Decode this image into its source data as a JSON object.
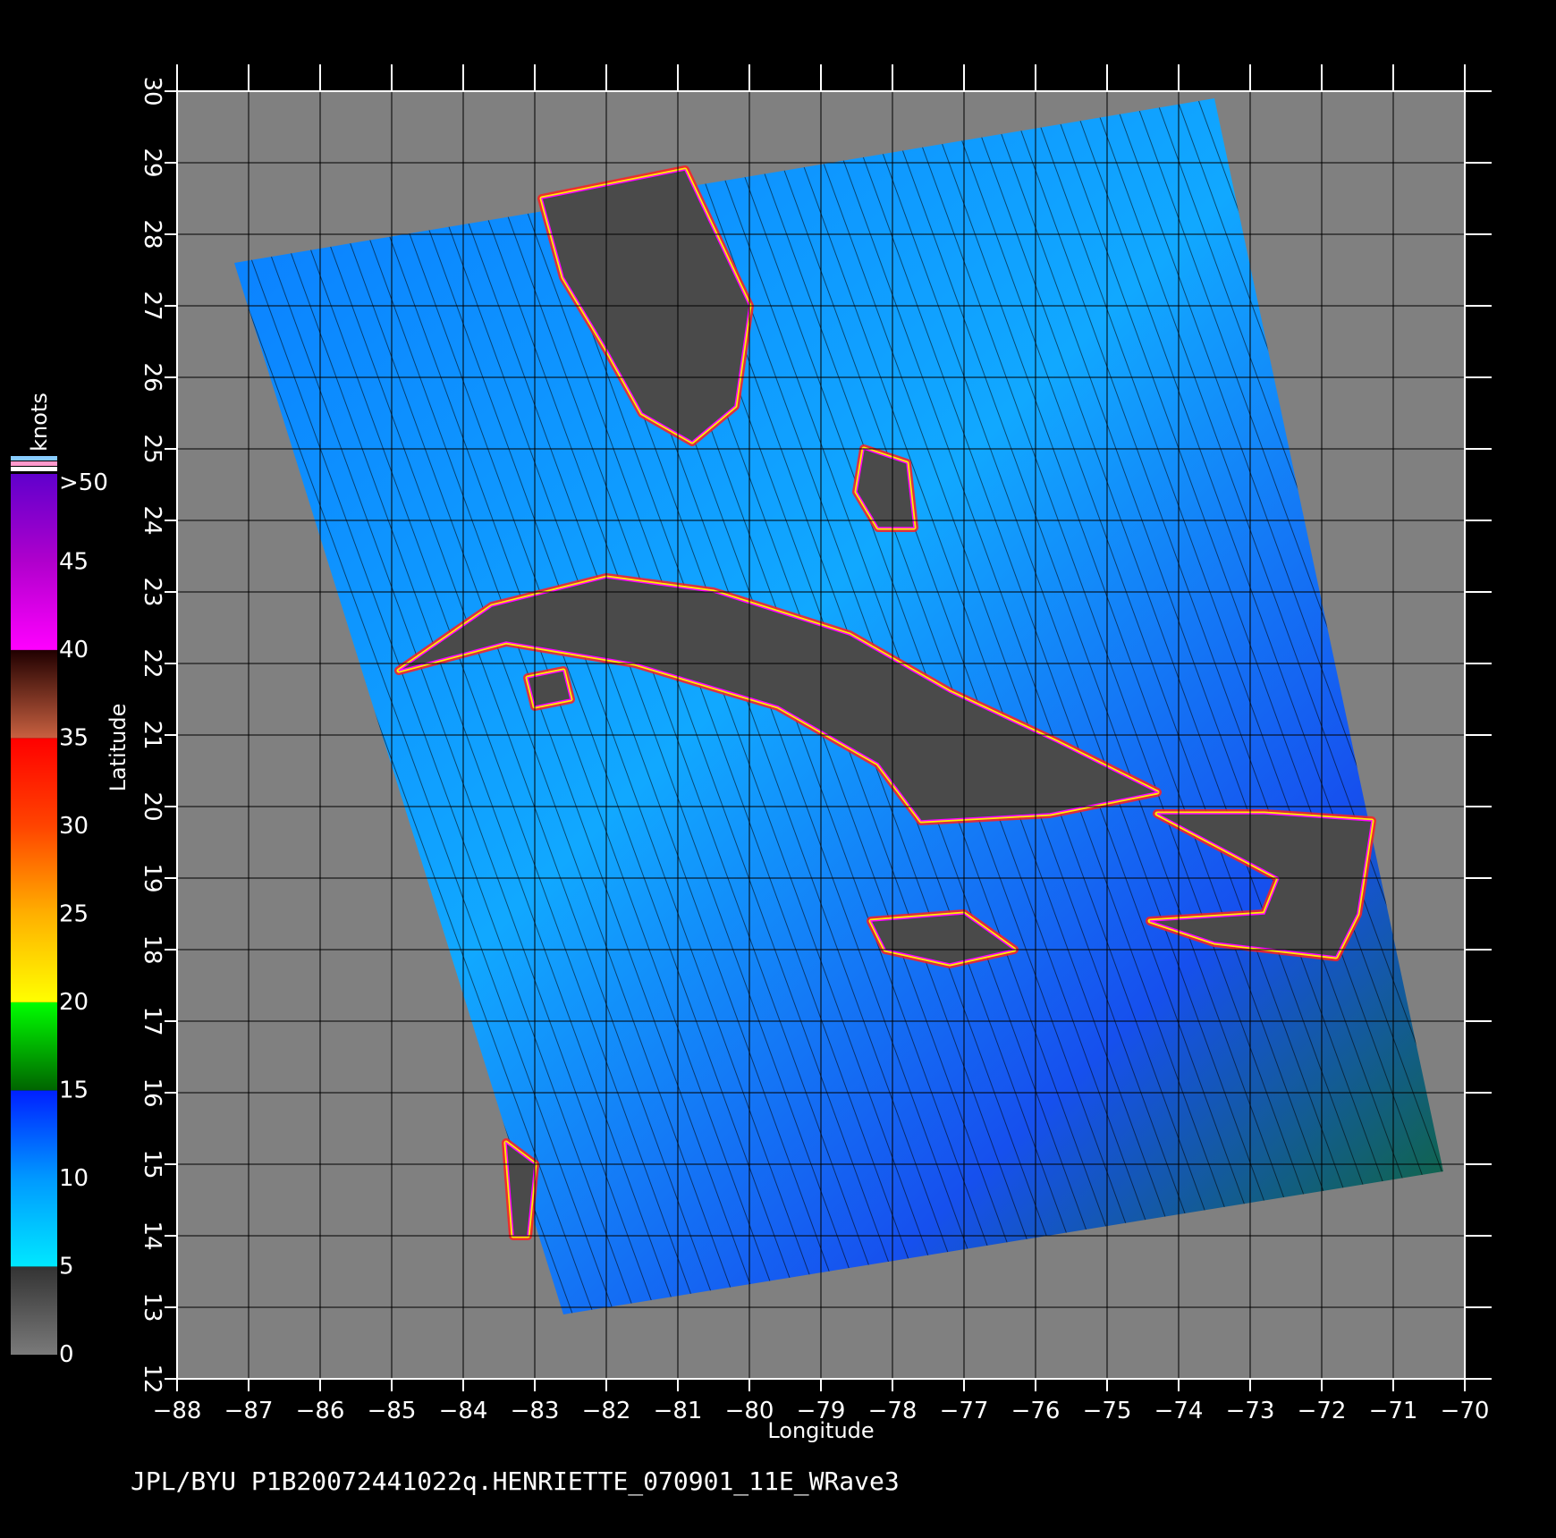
{
  "map": {
    "x_axis_title": "Longitude",
    "y_axis_title": "Latitude",
    "lon_range": [
      -88,
      -70
    ],
    "lat_range": [
      12,
      30
    ],
    "lon_ticks": [
      "−88",
      "−87",
      "−86",
      "−85",
      "−84",
      "−83",
      "−82",
      "−81",
      "−80",
      "−79",
      "−78",
      "−77",
      "−76",
      "−75",
      "−74",
      "−73",
      "−72",
      "−71",
      "−70"
    ],
    "lat_ticks": [
      "12",
      "13",
      "14",
      "15",
      "16",
      "17",
      "18",
      "19",
      "20",
      "21",
      "22",
      "23",
      "24",
      "25",
      "26",
      "27",
      "28",
      "29",
      "30"
    ],
    "swath_corners_lonlat": [
      [
        -87.2,
        27.6
      ],
      [
        -73.5,
        29.9
      ],
      [
        -70.3,
        14.9
      ],
      [
        -82.6,
        12.9
      ]
    ],
    "land_regions": [
      {
        "name": "florida",
        "points": [
          [
            -82.9,
            28.5
          ],
          [
            -80.9,
            28.9
          ],
          [
            -80.0,
            27.0
          ],
          [
            -80.2,
            25.6
          ],
          [
            -80.8,
            25.1
          ],
          [
            -81.5,
            25.5
          ],
          [
            -82.0,
            26.4
          ],
          [
            -82.6,
            27.4
          ]
        ]
      },
      {
        "name": "cuba",
        "points": [
          [
            -84.9,
            21.9
          ],
          [
            -83.6,
            22.8
          ],
          [
            -82.0,
            23.2
          ],
          [
            -80.5,
            23.0
          ],
          [
            -78.6,
            22.4
          ],
          [
            -77.2,
            21.6
          ],
          [
            -75.7,
            20.9
          ],
          [
            -74.3,
            20.2
          ],
          [
            -75.8,
            19.9
          ],
          [
            -77.6,
            19.8
          ],
          [
            -78.2,
            20.6
          ],
          [
            -79.6,
            21.4
          ],
          [
            -81.6,
            22.0
          ],
          [
            -83.4,
            22.3
          ]
        ]
      },
      {
        "name": "isla-de-la-juventud",
        "points": [
          [
            -83.1,
            21.8
          ],
          [
            -82.6,
            21.9
          ],
          [
            -82.5,
            21.5
          ],
          [
            -83.0,
            21.4
          ]
        ]
      },
      {
        "name": "andros",
        "points": [
          [
            -78.4,
            25.0
          ],
          [
            -77.8,
            24.8
          ],
          [
            -77.7,
            23.9
          ],
          [
            -78.2,
            23.9
          ],
          [
            -78.5,
            24.4
          ]
        ]
      },
      {
        "name": "hispaniola",
        "points": [
          [
            -74.3,
            19.9
          ],
          [
            -72.8,
            19.9
          ],
          [
            -71.3,
            19.8
          ],
          [
            -71.5,
            18.5
          ],
          [
            -71.8,
            17.9
          ],
          [
            -73.5,
            18.1
          ],
          [
            -74.4,
            18.4
          ],
          [
            -72.8,
            18.5
          ],
          [
            -72.6,
            19.0
          ]
        ]
      },
      {
        "name": "jamaica",
        "points": [
          [
            -78.3,
            18.4
          ],
          [
            -77.0,
            18.5
          ],
          [
            -76.3,
            18.0
          ],
          [
            -77.2,
            17.8
          ],
          [
            -78.1,
            18.0
          ]
        ]
      },
      {
        "name": "central-america-coast",
        "points": [
          [
            -83.4,
            15.3
          ],
          [
            -83.0,
            15.0
          ],
          [
            -83.1,
            14.0
          ],
          [
            -83.3,
            14.0
          ]
        ]
      }
    ],
    "colorbar": {
      "title": "knots",
      "labels": [
        ">50",
        "45",
        "40",
        "35",
        "30",
        "25",
        "20",
        "15",
        "10",
        "5",
        "0"
      ],
      "stops": [
        {
          "value": 0,
          "color": "#7a7a7a"
        },
        {
          "value": 5,
          "color": "#333333"
        },
        {
          "value": 5.01,
          "color": "#00e8ff"
        },
        {
          "value": 10,
          "color": "#0099ff"
        },
        {
          "value": 15,
          "color": "#0020ff"
        },
        {
          "value": 15.01,
          "color": "#006400"
        },
        {
          "value": 20,
          "color": "#00ff00"
        },
        {
          "value": 20.01,
          "color": "#ffff00"
        },
        {
          "value": 25,
          "color": "#ffb000"
        },
        {
          "value": 30,
          "color": "#ff4400"
        },
        {
          "value": 35,
          "color": "#ff0000"
        },
        {
          "value": 35.01,
          "color": "#c86040"
        },
        {
          "value": 40,
          "color": "#200000"
        },
        {
          "value": 40.01,
          "color": "#ff00ff"
        },
        {
          "value": 45,
          "color": "#b000cc"
        },
        {
          "value": 50,
          "color": "#6000cc"
        }
      ]
    },
    "colors": {
      "background": "#000000",
      "outside_swath": "#808080",
      "land": "#4a4a4a",
      "ocean_base": "#1e6eff",
      "grid": "#000000",
      "frame": "#ffffff"
    }
  },
  "footer": {
    "caption": "JPL/BYU  P1B20072441022q.HENRIETTE_070901_11E_WRave3"
  }
}
